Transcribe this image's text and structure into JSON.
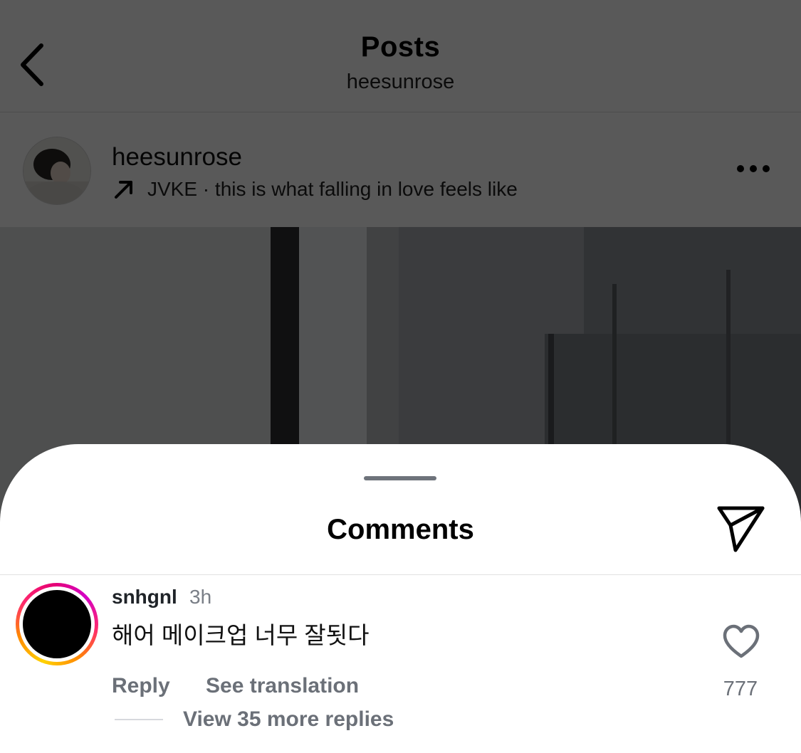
{
  "header": {
    "title": "Posts",
    "subtitle": "heesunrose"
  },
  "post": {
    "username": "heesunrose",
    "audio": "JVKE · this is what falling in love feels like"
  },
  "comments_sheet": {
    "title": "Comments",
    "comment": {
      "username": "snhgnl",
      "time": "3h",
      "text": "해어 메이크업 너무 잘됫다",
      "like_count": "777",
      "reply_label": "Reply",
      "translate_label": "See translation",
      "view_replies_label": "View 35 more replies"
    }
  },
  "colors": {
    "overlay": "#000000",
    "secondary_text": "#6b7078",
    "story_ring_start": "#ffd200",
    "story_ring_end": "#d300c5"
  },
  "icons": {
    "back": "chevron-left-icon",
    "audio": "arrow-up-right-icon",
    "more": "ellipsis-icon",
    "share": "paper-plane-icon",
    "like": "heart-outline-icon"
  }
}
